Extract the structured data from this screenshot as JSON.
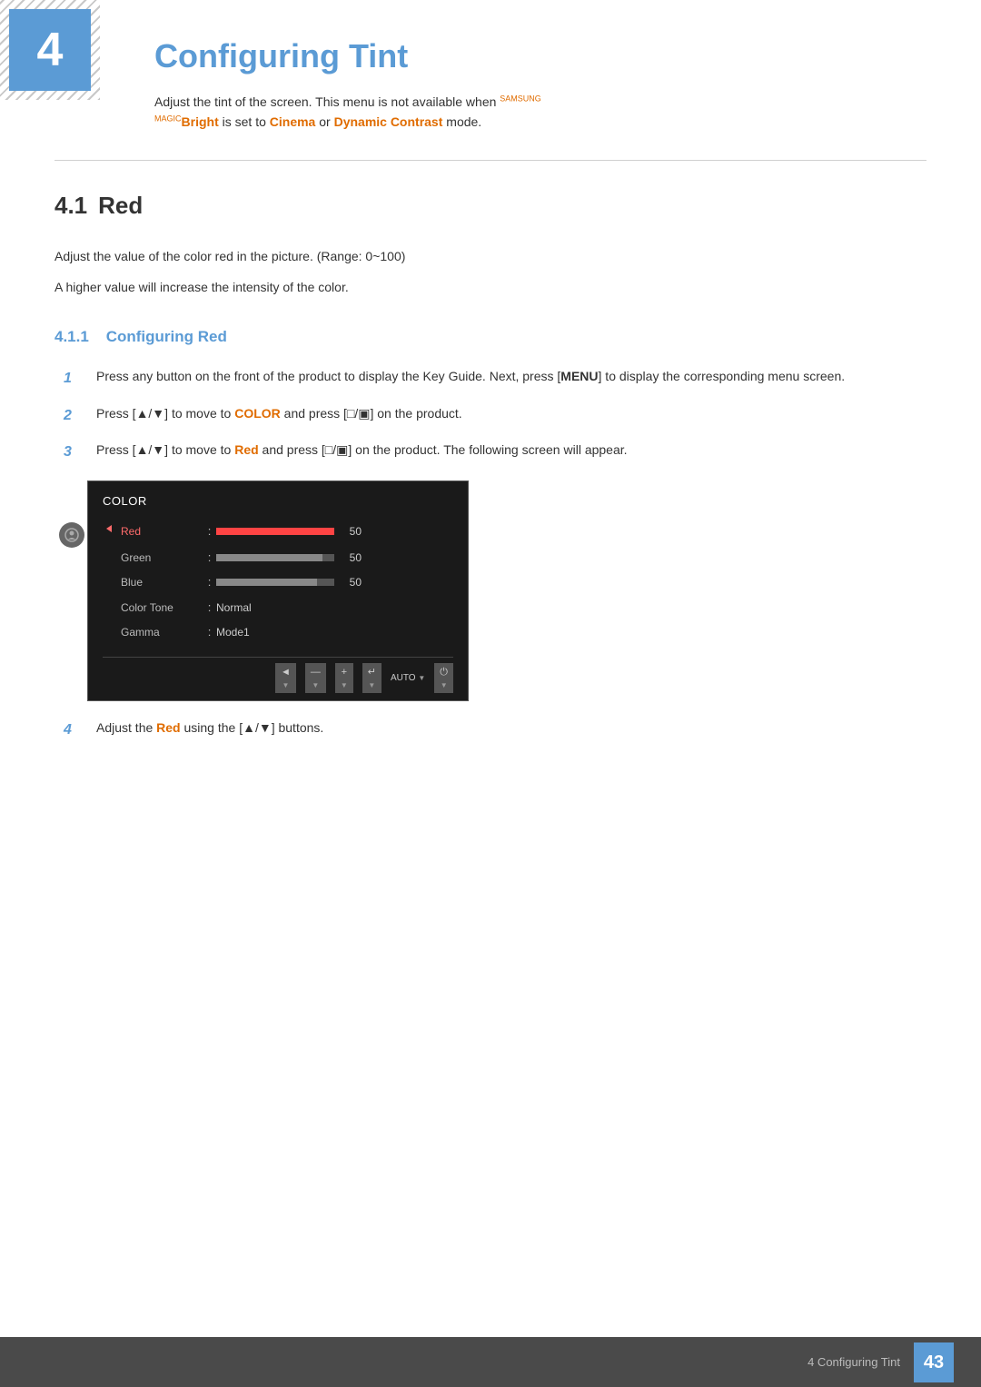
{
  "page": {
    "number": "43",
    "footer_label": "4 Configuring Tint"
  },
  "chapter": {
    "number": "4",
    "title": "Configuring Tint",
    "description_part1": "Adjust the tint of the screen. This menu is not available when ",
    "samsung_magic_text": "SAMSUNG\nMAGIC",
    "bright_label": "Bright",
    "description_part2": " is set to ",
    "cinema_label": "Cinema",
    "description_part3": " or ",
    "dynamic_contrast_label": "Dynamic Contrast",
    "description_part4": " mode."
  },
  "section_4_1": {
    "number": "4.1",
    "title": "Red",
    "body_1": "Adjust the value of the color red in the picture. (Range: 0~100)",
    "body_2": "A higher value will increase the intensity of the color.",
    "subsection": {
      "number": "4.1.1",
      "title": "Configuring Red",
      "steps": [
        {
          "num": "1",
          "text_1": "Press any button on the front of the product to display the Key Guide. Next, press [",
          "bold_1": "MENU",
          "text_2": "] to display the corresponding menu screen."
        },
        {
          "num": "2",
          "text_1": "Press [▲/▼] to move to ",
          "highlight_1": "COLOR",
          "text_2": " and press [□/▣] on the product."
        },
        {
          "num": "3",
          "text_1": "Press [▲/▼] to move to ",
          "highlight_1": "Red",
          "text_2": " and press [□/▣] on the product. The following screen will appear."
        },
        {
          "num": "4",
          "text_1": "Adjust the ",
          "highlight_1": "Red",
          "text_2": " using the [▲/▼] buttons."
        }
      ]
    }
  },
  "color_menu": {
    "title": "COLOR",
    "rows": [
      {
        "label": "Red",
        "type": "bar",
        "value": "50",
        "bar_type": "red",
        "active": true
      },
      {
        "label": "Green",
        "type": "bar",
        "value": "50",
        "bar_type": "green",
        "active": false
      },
      {
        "label": "Blue",
        "type": "bar",
        "value": "50",
        "bar_type": "blue",
        "active": false
      },
      {
        "label": "Color Tone",
        "type": "text",
        "value": "Normal",
        "active": false
      },
      {
        "label": "Gamma",
        "type": "text",
        "value": "Mode1",
        "active": false
      }
    ],
    "toolbar_buttons": [
      "◄",
      "—",
      "+",
      "↵",
      "AUTO",
      "⏻"
    ]
  }
}
